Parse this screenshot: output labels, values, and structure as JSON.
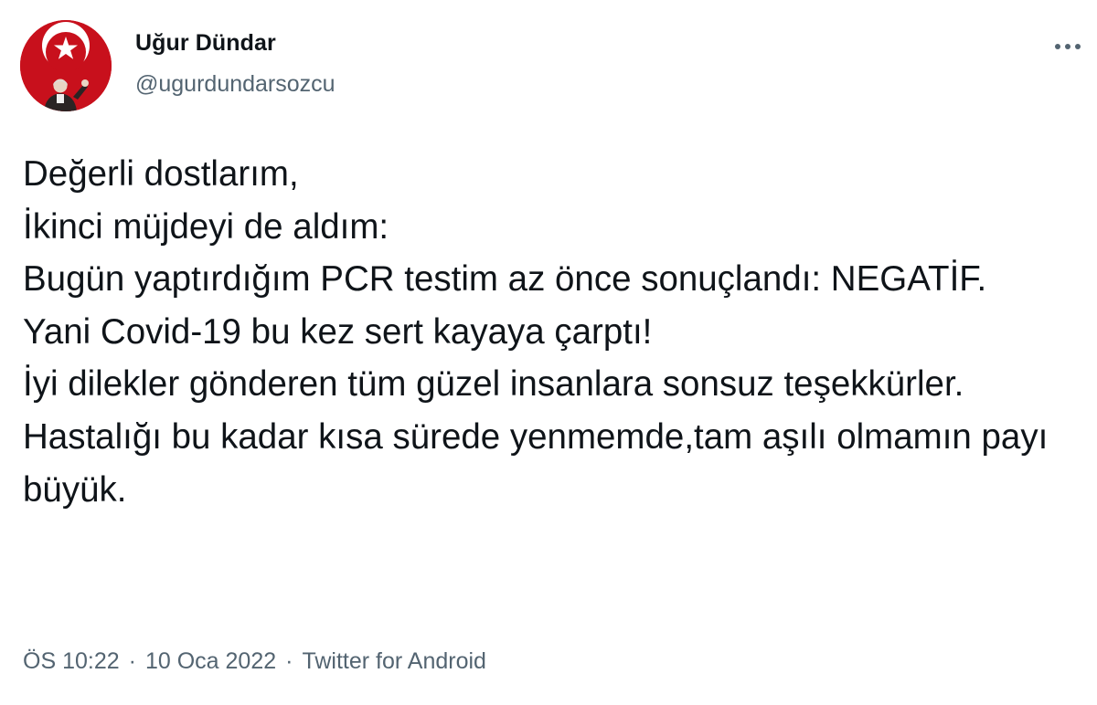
{
  "author": {
    "name": "Uğur Dündar",
    "handle": "@ugurdundarsozcu"
  },
  "tweet": {
    "text": "Değerli dostlarım,\nİkinci müjdeyi de aldım:\nBugün yaptırdığım PCR testim az önce sonuçlandı: NEGATİF.\nYani Covid-19 bu kez sert kayaya çarptı!\nİyi dilekler gönderen tüm güzel insanlara sonsuz teşekkürler.\nHastalığı bu kadar kısa sürede yenmemde,tam aşılı olmamın payı büyük.",
    "time": "ÖS 10:22",
    "date": "10 Oca 2022",
    "separator": "·",
    "source": "Twitter for Android"
  },
  "icons": {
    "avatar": "turkish-flag-profile-icon",
    "more": "more-options-icon"
  },
  "colors": {
    "text_primary": "#0f1419",
    "text_secondary": "#536471",
    "avatar_red": "#c8101c"
  }
}
